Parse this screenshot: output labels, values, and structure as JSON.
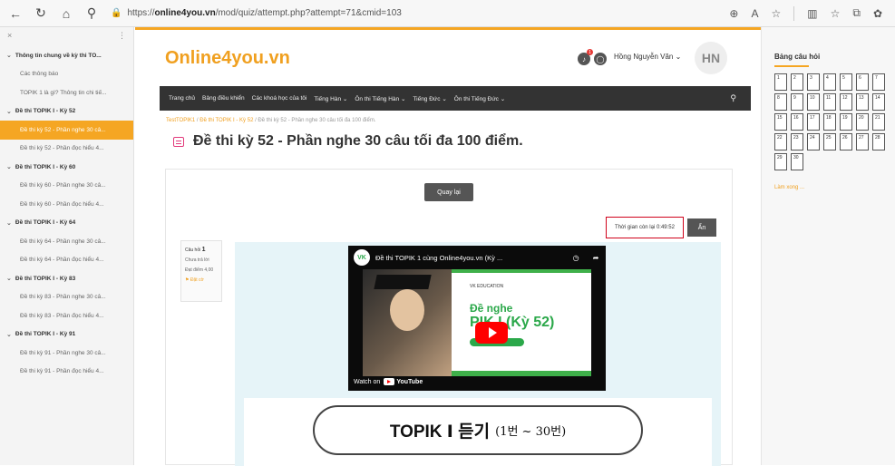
{
  "browser": {
    "url_prefix": "https://",
    "url_domain": "online4you.vn",
    "url_path": "/mod/quiz/attempt.php?attempt=71&cmid=103"
  },
  "sidebar": {
    "items": [
      {
        "type": "section",
        "label": "Thông tin chung về kỳ thi TO..."
      },
      {
        "type": "sub",
        "label": "Các thông báo"
      },
      {
        "type": "sub",
        "label": "TOPIK 1 là gì? Thông tin chi tiế..."
      },
      {
        "type": "section",
        "label": "Đề thi TOPIK I - Kỳ 52"
      },
      {
        "type": "sub",
        "label": "Đề thi kỳ 52 - Phần nghe 30 câ...",
        "active": true
      },
      {
        "type": "sub",
        "label": "Đề thi kỳ 52 - Phần đọc hiểu 4..."
      },
      {
        "type": "section",
        "label": "Đề thi TOPIK I - Kỳ 60"
      },
      {
        "type": "sub",
        "label": "Đề thi kỳ 60 - Phần nghe 30 câ..."
      },
      {
        "type": "sub",
        "label": "Đề thi kỳ 60 - Phần đọc hiểu 4..."
      },
      {
        "type": "section",
        "label": "Đề thi TOPIK I - Kỳ 64"
      },
      {
        "type": "sub",
        "label": "Đề thi kỳ 64 - Phần nghe 30 câ..."
      },
      {
        "type": "sub",
        "label": "Đề thi kỳ 64 - Phần đọc hiểu 4..."
      },
      {
        "type": "section",
        "label": "Đề thi TOPIK I - Kỳ 83"
      },
      {
        "type": "sub",
        "label": "Đề thi kỳ 83 - Phần nghe 30 câ..."
      },
      {
        "type": "sub",
        "label": "Đề thi kỳ 83 - Phần đọc hiểu 4..."
      },
      {
        "type": "section",
        "label": "Đề thi TOPIK I - Kỳ 91"
      },
      {
        "type": "sub",
        "label": "Đề thi kỳ 91 - Phần nghe 30 câ..."
      },
      {
        "type": "sub",
        "label": "Đề thi kỳ 91 - Phần đọc hiểu 4..."
      }
    ]
  },
  "header": {
    "brand": "Online4you.vn",
    "notification_count": "1",
    "username": "Hồng Nguyễn Văn",
    "avatar_initials": "HN",
    "accent_color": "#f5a623"
  },
  "navbar": {
    "items": [
      "Trang chủ",
      "Bảng điều khiển",
      "Các khoá học của tôi",
      "Tiếng Hàn ⌄",
      "Ôn thi Tiếng Hàn ⌄",
      "Tiếng Đức ⌄",
      "Ôn thi Tiếng Đức ⌄"
    ]
  },
  "breadcrumb": {
    "item1": "TestTOPIK1",
    "item2": "Đề thi TOPIK I - Kỳ 52",
    "item3": "Đề thi kỳ 52 - Phần nghe 30 câu tối đa 100 điểm."
  },
  "page": {
    "title": "Đề thi kỳ 52 - Phần nghe 30 câu tối đa 100 điểm."
  },
  "quiz": {
    "back_label": "Quay lại",
    "timer_text": "Thời gian còn lại 0:49:52",
    "hide_label": "Ẩn",
    "question_label": "Câu hỏi",
    "question_number": "1",
    "status": "Chưa trả lời",
    "points": "Đạt điểm 4,00",
    "flag": "Đặt cờ"
  },
  "video": {
    "title": "Đề thi TOPIK 1 cùng Online4you.vn (Kỳ ...",
    "logo_text": "VK",
    "edu_label": "VK EDUCATION",
    "heading1": "Đề nghe",
    "heading2": "PIK I (Kỳ 52)",
    "watch_on": "Watch on",
    "youtube": "YouTube"
  },
  "listening_banner": {
    "part1": "TOPIK Ⅰ 듣기",
    "part2": "(1번 ~ 30번)"
  },
  "question_nav": {
    "title": "Bảng câu hỏi",
    "numbers": [
      "1",
      "2",
      "3",
      "4",
      "5",
      "6",
      "7",
      "8",
      "9",
      "10",
      "11",
      "12",
      "13",
      "14",
      "15",
      "16",
      "17",
      "18",
      "19",
      "20",
      "21",
      "22",
      "23",
      "24",
      "25",
      "26",
      "27",
      "28",
      "29",
      "30"
    ],
    "finish_label": "Làm xong ..."
  }
}
